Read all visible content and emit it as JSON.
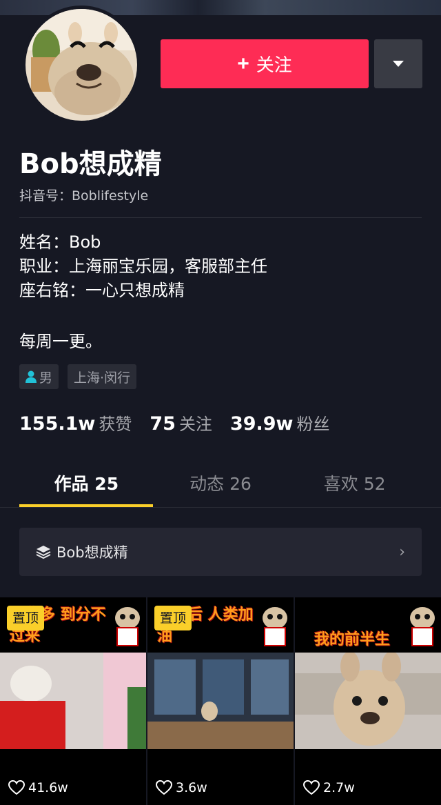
{
  "profile": {
    "follow_label": "关注",
    "name": "Bob想成精",
    "douyin_id": "抖音号：Boblifestyle",
    "bio_lines": [
      "姓名：Bob",
      "职业：上海丽宝乐园，客服部主任",
      "座右铭：一心只想成精"
    ],
    "bio_extra": "每周一更。",
    "tags": {
      "gender": "男",
      "location": "上海·闵行"
    }
  },
  "stats": [
    {
      "value": "155.1w",
      "label": "获赞"
    },
    {
      "value": "75",
      "label": "关注"
    },
    {
      "value": "39.9w",
      "label": "粉丝"
    }
  ],
  "tabs": [
    {
      "label": "作品",
      "count": "25"
    },
    {
      "label": "动态",
      "count": "26"
    },
    {
      "label": "喜欢",
      "count": "52"
    }
  ],
  "collection": {
    "label": "Bob想成精"
  },
  "videos": [
    {
      "pinned": "置顶",
      "banner": "是非多 到分不过来",
      "likes": "41.6w"
    },
    {
      "pinned": "置顶",
      "banner": "到最后 人类加油",
      "likes": "3.6w"
    },
    {
      "pinned": "",
      "banner": "我的前半生",
      "likes": "2.7w"
    }
  ],
  "colors": {
    "accent": "#fe2c55",
    "tab_indicator": "#facf2a",
    "background": "#161823"
  }
}
